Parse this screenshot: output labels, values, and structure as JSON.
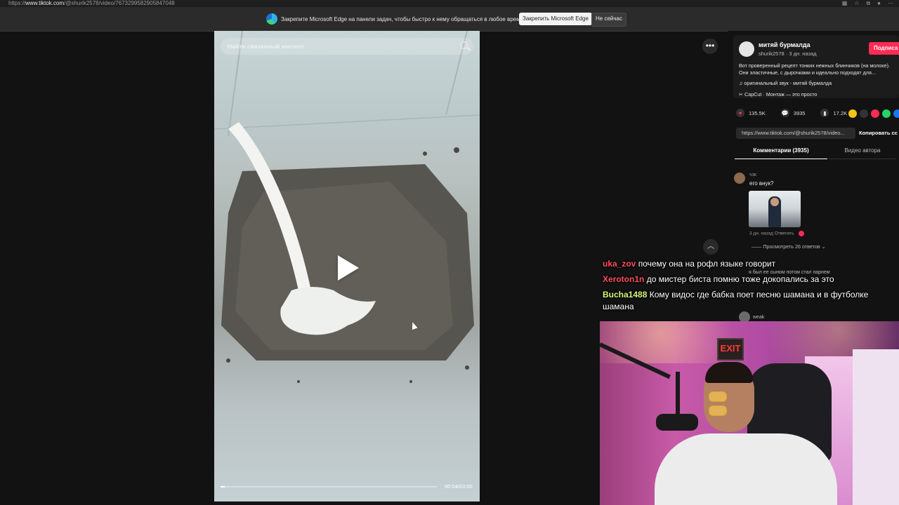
{
  "browser": {
    "url_prefix": "https://",
    "url_domain": "www.tiktok.com",
    "url_rest": "/@shurik2578/video/7673299582905847048"
  },
  "edge_bar": {
    "message": "Закрепите Microsoft Edge на панели задач, чтобы быстро к нему обращаться в любое время",
    "pin_label": "Закрепить Microsoft Edge",
    "dismiss_label": "Не сейчас"
  },
  "video": {
    "search_placeholder": "Найти связанный контент",
    "time": "00:04/03:00",
    "progress_fraction": 0.02
  },
  "post": {
    "username": "митяй бурмалда",
    "handle": "shurik2578 · 3 дн. назад",
    "follow_label": "Подписа",
    "description": "Вот проверенный рецепт тонких нежных блинчиков (на молоке). Они эластичные, с дырочками и идеально подходят для...",
    "sound": "оригинальный звук - митяй бурмалда",
    "capcut": "CapCut · Монтаж — это просто",
    "likes": "135.5K",
    "comments": "3935",
    "saves": "17.2K",
    "link": "https://www.tiktok.com/@shurik2578/video...",
    "copy_label": "Копировать сс",
    "tabs": [
      "Комментарии (3935)",
      "Видео автора"
    ]
  },
  "comment": {
    "author": "чзк",
    "text": "его внук?",
    "meta": "3 дн. назад   Ответить",
    "replies": "Просмотреть 26 ответов",
    "ghost_text": "я был ее сыном потом стал парнем",
    "next_author": "weak"
  },
  "chat": [
    {
      "user": "uka_zov",
      "text": "почему она на рофл языке говорит"
    },
    {
      "user": "Xeroton1n",
      "text": "до мистер биста помню тоже докопались за это"
    },
    {
      "user": "Bucha1488",
      "text": "Кому видос где бабка поет песню шамана и в футболке шамана"
    }
  ],
  "colors": {
    "accent": "#fe2c55",
    "chat_user_red": "#ff4d5e",
    "chat_user_green": "#d6f57a"
  }
}
